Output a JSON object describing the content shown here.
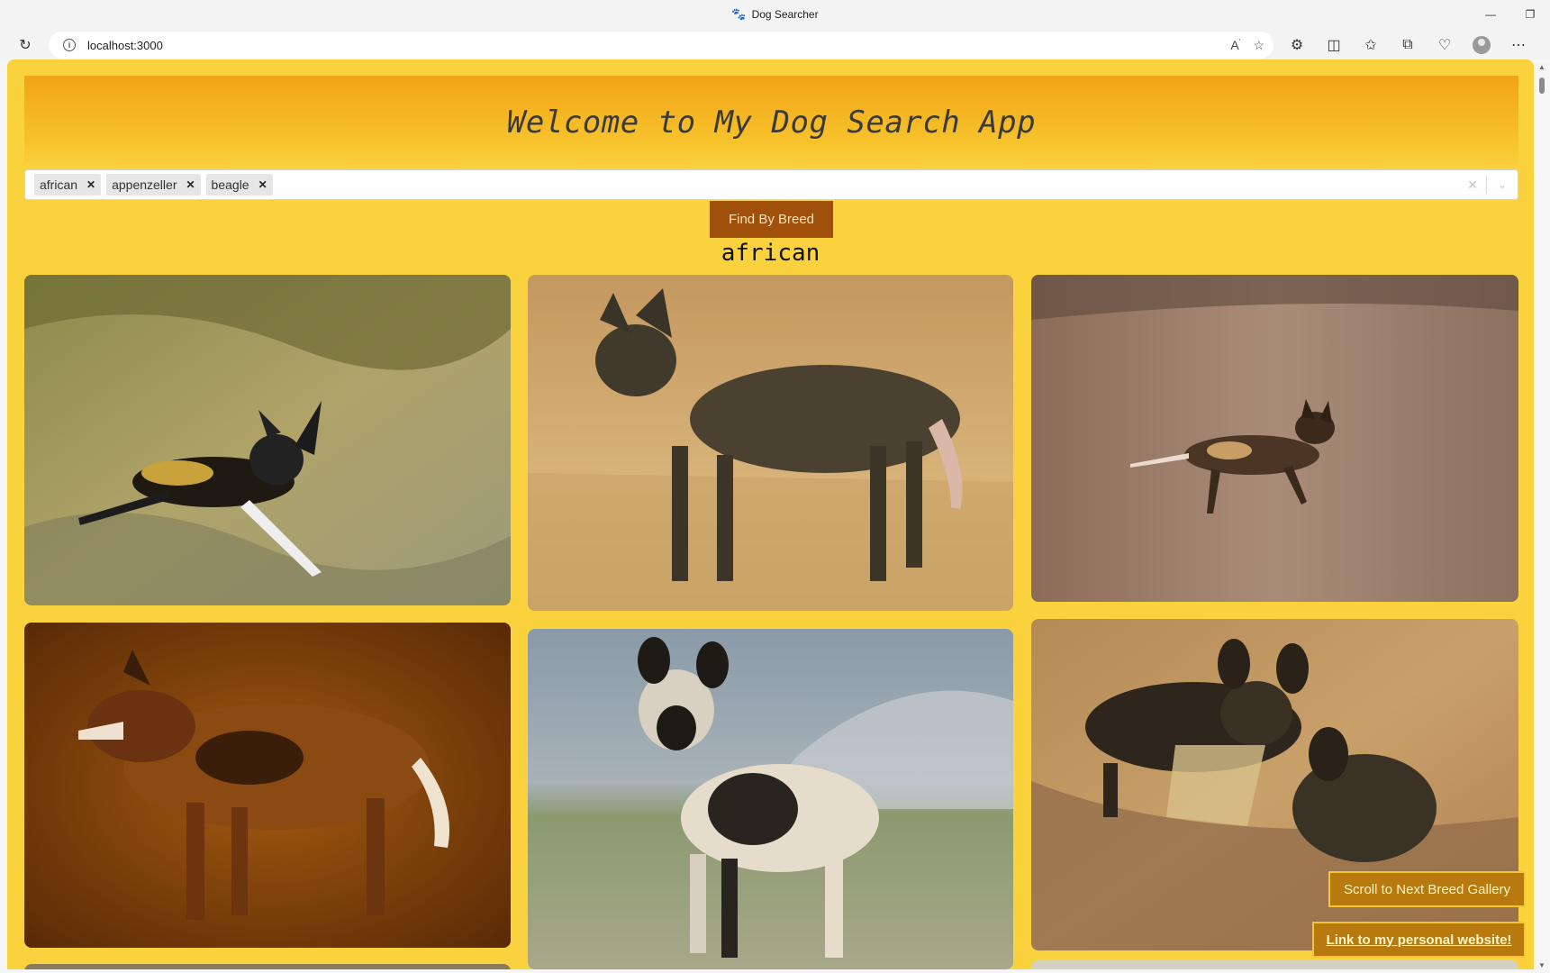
{
  "browser": {
    "tab_title": "Dog Searcher",
    "tab_icon": "paw-icon",
    "url": "localhost:3000"
  },
  "page": {
    "heading": "Welcome to My Dog Search App",
    "selected_breeds": [
      {
        "label": "african"
      },
      {
        "label": "appenzeller"
      },
      {
        "label": "beagle"
      }
    ],
    "find_button": "Find By Breed",
    "current_breed": "african",
    "scroll_next_button": "Scroll to Next Breed Gallery",
    "personal_link": "Link to my personal website!"
  },
  "colors": {
    "page_background": "#fad23e",
    "button_brown": "#a0500a",
    "floating_button": "#b87a0e"
  }
}
